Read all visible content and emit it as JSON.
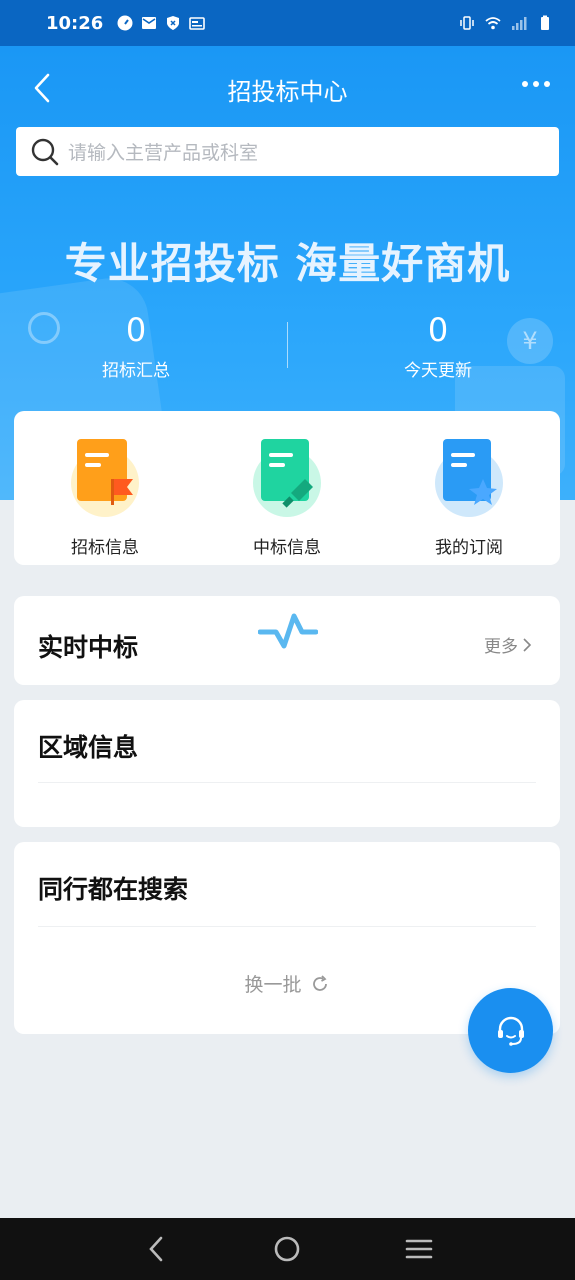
{
  "status_bar": {
    "time": "10:26",
    "left_icons": [
      "speed-icon",
      "mail-icon",
      "shield-icon",
      "card-icon"
    ],
    "right_icons": [
      "vibrate-icon",
      "wifi-icon",
      "signal-icon",
      "battery-icon"
    ]
  },
  "nav": {
    "title": "招投标中心",
    "back_icon": "chevron-left-icon",
    "more_icon": "more-icon"
  },
  "search": {
    "placeholder": "请输入主营产品或科室"
  },
  "hero": {
    "slogan": "专业招投标 海量好商机",
    "stats": [
      {
        "value": "0",
        "label": "招标汇总"
      },
      {
        "value": "0",
        "label": "今天更新"
      }
    ]
  },
  "categories": [
    {
      "label": "招标信息",
      "icon": "bid-info-icon",
      "color": "#ff9f1a"
    },
    {
      "label": "中标信息",
      "icon": "award-info-icon",
      "color": "#1fd4a0"
    },
    {
      "label": "我的订阅",
      "icon": "subscription-icon",
      "color": "#2a9bf5"
    }
  ],
  "realtime": {
    "title": "实时中标",
    "more": "更多"
  },
  "region": {
    "title": "区域信息"
  },
  "peers": {
    "title": "同行都在搜索",
    "refresh": "换一批"
  },
  "colors": {
    "primary": "#1a97f5",
    "status_bar": "#0a66c2",
    "fab": "#1a8ff0"
  }
}
